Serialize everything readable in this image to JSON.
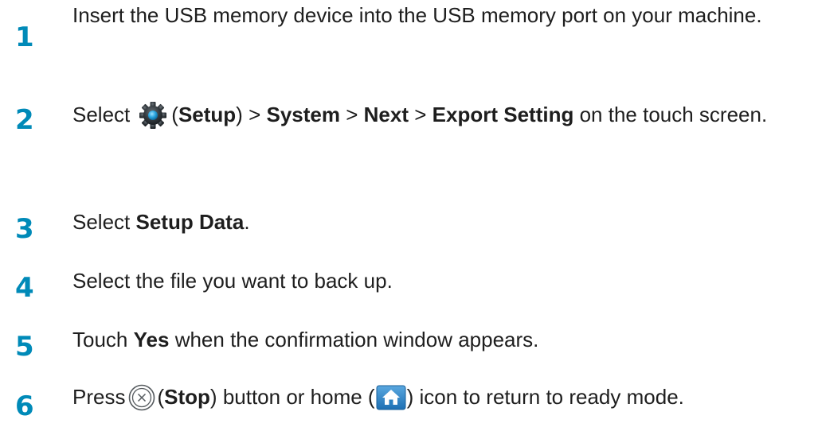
{
  "steps": [
    {
      "number": "1",
      "text": "Insert the USB memory device into the USB memory port on your machine."
    },
    {
      "number": "2",
      "select": "Select",
      "setup_open": "(",
      "setup": "Setup",
      "setup_close": ")",
      "sep1": ">",
      "system": "System",
      "sep2": ">",
      "next": "Next",
      "sep3": ">",
      "export_setting": "Export Setting",
      "tail": "on the touch screen.",
      "icon": "gear-icon"
    },
    {
      "number": "3",
      "select": "Select",
      "setup_data": "Setup Data",
      "period": "."
    },
    {
      "number": "4",
      "text": "Select the file you want to back up."
    },
    {
      "number": "5",
      "touch": "Touch",
      "yes": "Yes",
      "tail": "when the confirmation window appears."
    },
    {
      "number": "6",
      "press": "Press",
      "stop_open": "(",
      "stop": "Stop",
      "stop_close": ")",
      "button_or_home": "button or home (",
      "tail": ") icon to return to ready mode.",
      "icons": [
        "stop-icon",
        "home-icon"
      ]
    }
  ],
  "colors": {
    "step_number": "#008ab8",
    "text": "#1e1e1e",
    "home_icon_bg": "#2a7fc0"
  }
}
